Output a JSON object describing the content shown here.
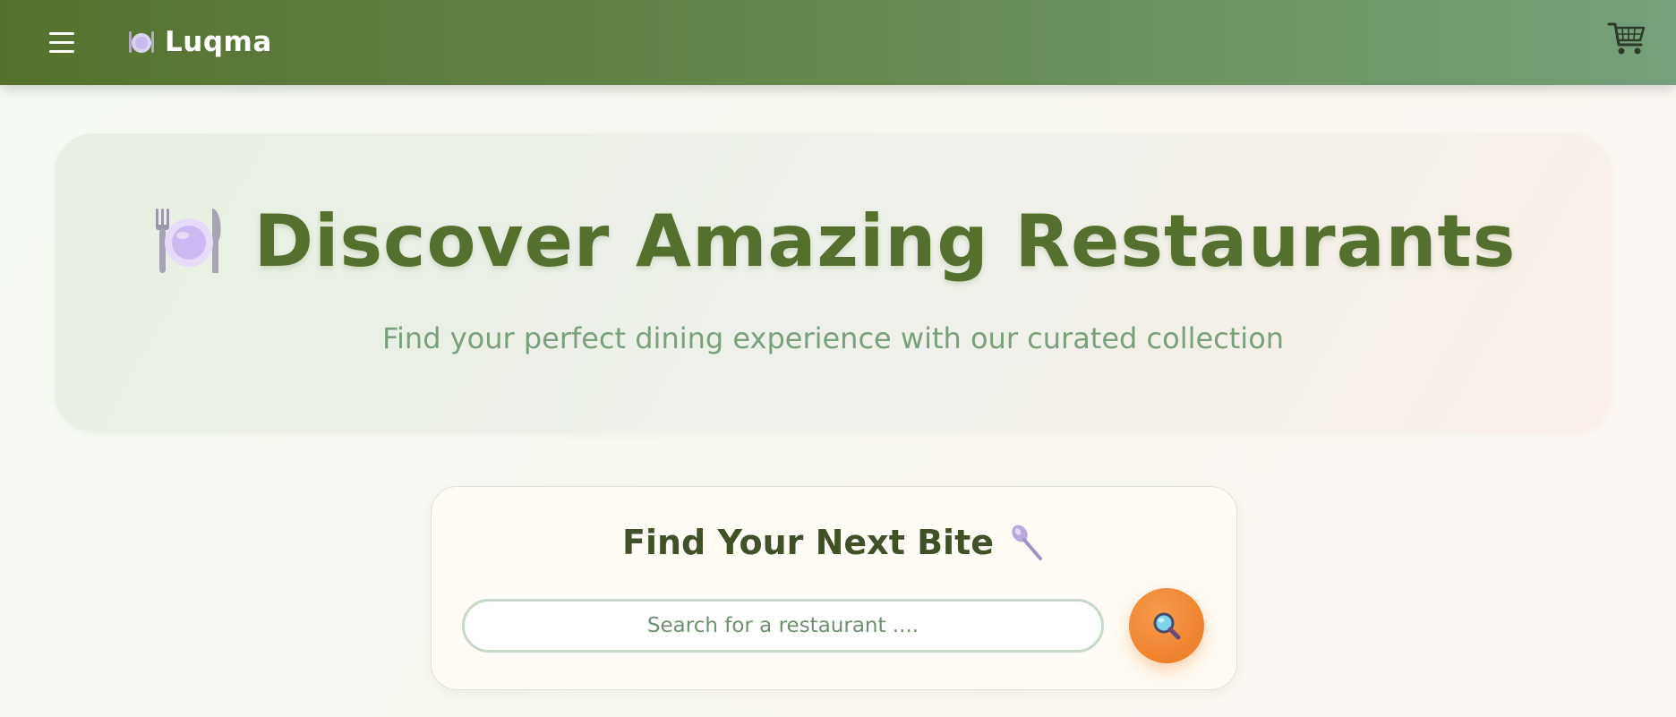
{
  "navbar": {
    "menu_icon": "hamburger-icon",
    "logo_icon": "plate-icon",
    "brand_name": "Luqma",
    "cart_icon": "shopping-cart-icon",
    "colors": {
      "start": "#55712d",
      "end": "#76a07b"
    }
  },
  "hero": {
    "icon": "fork-knife-plate-icon",
    "title": "Discover Amazing Restaurants",
    "subtitle": "Find your perfect dining experience with our curated collection",
    "colors": {
      "title": "#55702e",
      "subtitle": "#79a07a"
    }
  },
  "search": {
    "title": "Find Your Next Bite",
    "title_icon": "spoon-icon",
    "placeholder": "Search for a restaurant ....",
    "value": "",
    "button_icon": "magnifier-icon",
    "colors": {
      "button": "#f08632"
    }
  }
}
